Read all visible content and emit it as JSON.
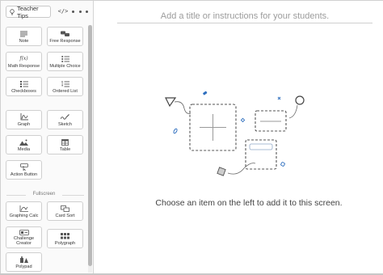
{
  "sidebar": {
    "teacher_tips_label": "Teacher Tips",
    "code_toggle_label": "</>",
    "components": [
      {
        "label": "Note",
        "icon": "note-icon"
      },
      {
        "label": "Free Response",
        "icon": "free-response-icon"
      },
      {
        "label": "Math Response",
        "icon": "math-response-icon",
        "icon_text": "f(x)"
      },
      {
        "label": "Multiple Choice",
        "icon": "multiple-choice-icon"
      },
      {
        "label": "Checkboxes",
        "icon": "checkboxes-icon"
      },
      {
        "label": "Ordered List",
        "icon": "ordered-list-icon"
      },
      {
        "label": "Graph",
        "icon": "graph-icon"
      },
      {
        "label": "Sketch",
        "icon": "sketch-icon"
      },
      {
        "label": "Media",
        "icon": "media-icon"
      },
      {
        "label": "Table",
        "icon": "table-icon"
      },
      {
        "label": "Action Button",
        "icon": "action-button-icon"
      }
    ],
    "fullscreen_label": "Fullscreen",
    "fullscreen_components": [
      {
        "label": "Graphing Calc",
        "icon": "graphing-calc-icon"
      },
      {
        "label": "Card Sort",
        "icon": "card-sort-icon"
      },
      {
        "label": "Challenge Creator",
        "icon": "challenge-creator-icon"
      },
      {
        "label": "Polygraph",
        "icon": "polygraph-icon"
      },
      {
        "label": "Polypad",
        "icon": "polypad-icon"
      }
    ]
  },
  "main": {
    "title_placeholder": "Add a title or instructions for your students.",
    "empty_hint": "Choose an item on the left to add it to this screen."
  },
  "colors": {
    "accent": "#2f6fbf",
    "border": "#cfcfcf",
    "dashed": "#555555"
  }
}
